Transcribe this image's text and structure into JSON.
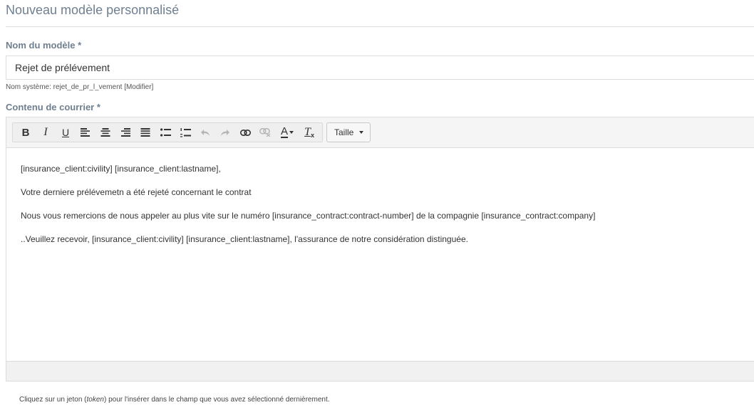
{
  "page": {
    "title": "Nouveau modèle personnalisé"
  },
  "name_field": {
    "label": "Nom du modèle",
    "required_mark": "*",
    "value": "Rejet de prélévement",
    "system_name_prefix": "Nom système: rejet_de_pr_l_vement",
    "modify_label": "[Modifier]"
  },
  "content_field": {
    "label": "Contenu de courrier",
    "required_mark": "*"
  },
  "toolbar": {
    "buttons": [
      "bold",
      "italic",
      "underline",
      "align-left",
      "align-center",
      "align-right",
      "align-justify",
      "bulleted-list",
      "numbered-list",
      "undo",
      "redo",
      "link",
      "unlink",
      "text-color",
      "remove-format"
    ],
    "bold": "B",
    "italic": "I",
    "underline": "U",
    "text_color": "A",
    "remove_format": "T",
    "size_label": "Taille"
  },
  "editor": {
    "paragraphs": [
      "[insurance_client:civility] [insurance_client:lastname],",
      "Votre derniere prélévemetn a été rejeté concernant le contrat",
      "Nous vous remercions de nous appeler au plus vite sur le numéro [insurance_contract:contract-number] de la compagnie [insurance_contract:company]",
      "..Veuillez recevoir, [insurance_client:civility] [insurance_client:lastname], l'assurance de notre considération distinguée."
    ]
  },
  "hint": {
    "before": "Cliquez sur un jeton (",
    "token_word": "token",
    "after": ") pour l'insérer dans le champ que vous avez sélectionné dernièrement."
  }
}
